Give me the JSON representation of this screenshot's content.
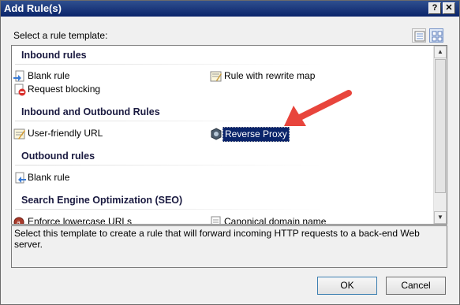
{
  "window": {
    "title": "Add Rule(s)",
    "help_label": "?",
    "close_label": "✕"
  },
  "select_label": "Select a rule template:",
  "view_buttons": [
    {
      "icon": "details-view-icon"
    },
    {
      "icon": "tiles-view-icon"
    }
  ],
  "groups": [
    {
      "header": "Inbound rules",
      "items": [
        {
          "label": "Blank rule",
          "icon": "blank-rule-icon"
        },
        {
          "label": "Rule with rewrite map",
          "icon": "rewrite-map-icon"
        },
        {
          "label": "Request blocking",
          "icon": "request-blocking-icon"
        }
      ]
    },
    {
      "header": "Inbound and Outbound Rules",
      "items": [
        {
          "label": "User-friendly URL",
          "icon": "user-friendly-url-icon"
        },
        {
          "label": "Reverse Proxy",
          "icon": "reverse-proxy-icon",
          "selected": true
        }
      ]
    },
    {
      "header": "Outbound rules",
      "items": [
        {
          "label": "Blank rule",
          "icon": "blank-rule-icon"
        }
      ]
    },
    {
      "header": "Search Engine Optimization (SEO)",
      "items": [
        {
          "label": "Enforce lowercase URLs",
          "icon": "lowercase-url-icon"
        },
        {
          "label": "Canonical domain name",
          "icon": "canonical-domain-icon"
        }
      ]
    }
  ],
  "description": "Select this template to create a rule that will forward incoming HTTP requests to a back-end Web server.",
  "buttons": {
    "ok": "OK",
    "cancel": "Cancel"
  },
  "colors": {
    "titlebar": "#0a246a",
    "selection": "#0a246a",
    "annotation_arrow": "#e8453c"
  }
}
